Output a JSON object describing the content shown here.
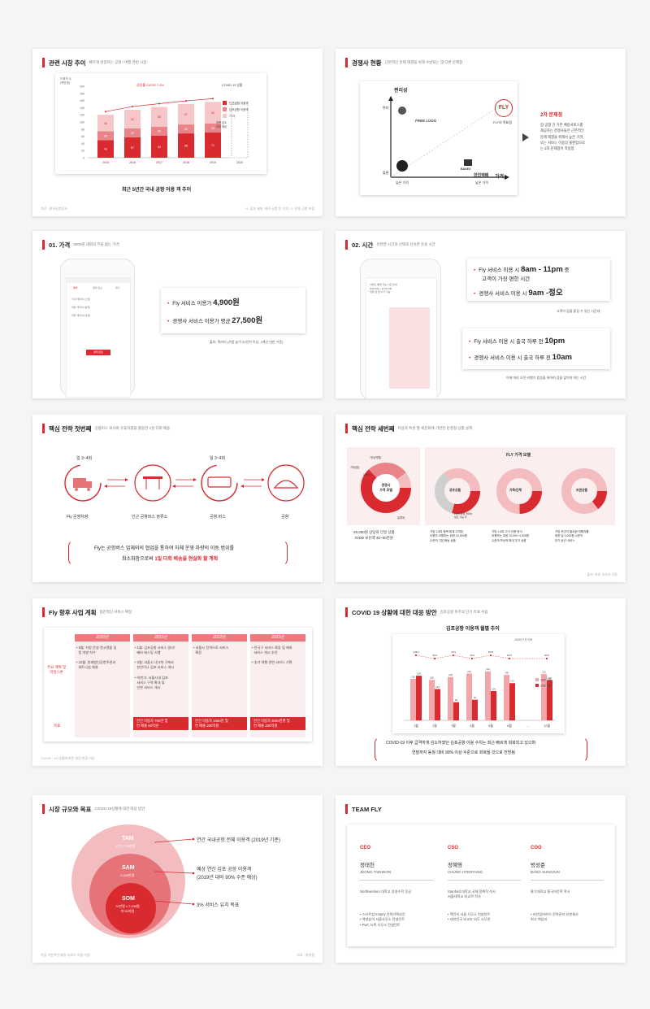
{
  "s1": {
    "title": "관련 시장 추이",
    "subtitle": "빠르게 성장하는 공항 / 여행 관련 시장",
    "y_label": "이용객 수\n(백만명)",
    "y_ticks": [
      "200",
      "180",
      "160",
      "140",
      "120",
      "100",
      "80",
      "60",
      "40",
      "20",
      "0"
    ],
    "growth": "성장률 CAGR 7.4%",
    "covid_note": "COVID 19 상황",
    "dashed_note": "대폭 감소\n미정 예상",
    "legend": [
      "인천공항 이용객",
      "김포공항 이용객",
      "기 타"
    ],
    "caption": "최근 5년간 국내 공항 이용 객 추이",
    "foot_left": "자료 : 한국공항공사",
    "foot_right": "*1. 김포 제외, 제주 공항 등 지역 / 2. 전체 공항 포함",
    "chart_data": {
      "type": "bar",
      "categories": [
        "2015",
        "2016",
        "2017",
        "2018",
        "2019",
        "2020"
      ],
      "series": [
        {
          "name": "인천공항 이용객",
          "values": [
            49,
            57,
            62,
            68,
            71,
            null
          ]
        },
        {
          "name": "김포공항 이용객",
          "values": [
            25,
            25,
            25,
            25,
            25,
            null
          ]
        },
        {
          "name": "기 타",
          "values": [
            46,
            52,
            55,
            57,
            60,
            null
          ]
        }
      ],
      "segment_labels": [
        [
          "49",
          "25",
          "46"
        ],
        [
          "57",
          "25",
          "52"
        ],
        [
          "62",
          "25",
          "55"
        ],
        [
          "68",
          "25",
          "57"
        ],
        [
          "71",
          "25",
          "60"
        ]
      ],
      "ylim": [
        0,
        200
      ]
    }
  },
  "s2": {
    "title": "경쟁사 현황",
    "subtitle": "근본적인 문제 해결을 위해 수반되는 및 다른 문제점",
    "y_axis": "편리성",
    "x_axis": "가격",
    "high": "편리",
    "low": "불편",
    "x_low": "높은 가격",
    "x_high": "낮은 가격",
    "fly_logo": "FLY",
    "fly_label": "FLY의 목표점",
    "comp1": "FREE LUGG",
    "comp2": "BAGEX",
    "comp3": "한진택배",
    "right_title": "2차 문제점",
    "right_body": "집-공항 간 기존 배송서비스를\n제공하는 경쟁사들은 근본적인\n문제 해결을 위해서 높은 가격,\n또는 서비스 이용의 불편함으로\n는 2차 문제점이 작용함"
  },
  "s3": {
    "title": "01. 가격",
    "subtitle": "5000원 내외의 부담 없는 가격",
    "b1": "Fly 서비스 이용가 ",
    "b1v": "4,900원",
    "b2": "경쟁사 서비스 이용가 평균 ",
    "b2v": "27,500원",
    "note": "출처: 뭐라더 (가방 높이 20인치 이상, 3개인 미만 기준)",
    "phone_tabs": [
      "예약",
      "결제 정보",
      "확인"
    ],
    "phone_rows": [
      "기내 캐리어 (소형)",
      "위탁 캐리어 (중형)",
      "위탁 캐리어 (대형)"
    ],
    "phone_btn": "결제 완료"
  },
  "s4": {
    "title": "02. 시간",
    "subtitle": "유연한 시간과 선택과 신속한 운송 시간",
    "b1a": "Fly 서비스 이용 시 ",
    "b1v": "8am - 11pm",
    "b1b": " 중",
    "b1c": "고객이 가장 편한 시간",
    "b2a": "경쟁사 서비스 이용 시 ",
    "b2v": "9am -정오",
    "note1": "고객이 짐을 맡길 수 있는 시간대",
    "b3a": "Fly 서비스 이용 시 출국 하루 전 ",
    "b3v": "10pm",
    "b4a": "경쟁사 서비스 이용 시 출국 하루 전 ",
    "b4v": "10am",
    "note2": "이에 따라 오전 비행기 탑승을 위하여 짐을 맡겨야 하는 시간",
    "phone_text": "서비스 예약 가능 시간 안내\n8:00 AM ~ 11:00 PM\n당일 집 앞 수거 가능"
  },
  "s5": {
    "title": "핵심 전략 첫번째",
    "subtitle": "공항버스 회사와 유휴자원을 활용한 1일 다회 배송",
    "step_top1": "일 3~4회",
    "step_top2": "일 3~4회",
    "items": [
      "Fly 운영차량",
      "인근 공항버스 정류소",
      "공항 버스",
      "공항"
    ],
    "body1": "Fly는 공항버스 업체와의 협업을 통하여 차체 운영 차량의 이동 범위를",
    "body2a": "최소화함으로써 ",
    "body2b": "1일 다회 배송을 현실화 할 계획"
  },
  "s6": {
    "title": "핵심 전략 세번째",
    "subtitle": "이용자 특성 별 세분화에 기반한 운영형 상품 설계",
    "left_circle": "경쟁사\n가격 모델",
    "left_labels": [
      "기타(약원)",
      "기타(방)",
      "10%",
      "유류비"
    ],
    "left_caption": "25,000원 상당의 단일 상품\n/ODD 보유액 30~50만원",
    "right_title": "FLY 가격 모델",
    "circles": [
      "공유상품",
      "가족/단체",
      "보관상품"
    ],
    "circle_notes": [
      "Fly의 대형 캐리어\n필요 가능 후"
    ],
    "descs": [
      "가방 1,8여 품목 회계 고객된\n이용자 여행하는 위한 15,000원\n수준의 기본 배송 상품",
      "가방 1.8여 고가 이용 방식\n여행하는 위한 10,000~4,900원\n수준의 보상적 확대 무가 상품",
      "가방 보관이 필요한 여행자를\n위한 일 4,900원 수준의\n부가 상관 서비스"
    ],
    "foot": "출처: 자료 리서치 기준"
  },
  "s7": {
    "title": "Fly 향후 사업 계획",
    "subtitle": "점진적인 서비스 확장",
    "years": [
      "2020년",
      "2021년",
      "2022년",
      "2023년"
    ],
    "row1": "주요 계획 및\n마일스톤",
    "row2": "목표",
    "cells": [
      "• 8월: 차량 운영 렌고렌을 및\n  랩 개발 착수\n\n• 10월: 관세법인공항주관과\n  파트너십 체결",
      "• 1월: 김포공항 서비스 말리/\n  베타 테스팅 시행\n\n• 3월: 서울시 내 3개 구에서\n  한전이나 김포 서비스 개시\n\n• 하반기: 서울시내 김포\n  서비스 구역 확대 및\n  인천 서비스 개시",
      "• 서울시 전역으로 서비스\n  확장",
      "• 전국구 서비스 확장 및 해외\n  서비스 개시 추진\n\n• 추가 여행 관련 서비스 기획"
    ],
    "goals": [
      "연간 이용자 700만 및\n연 매출 50억원",
      "연간 이용자 1960만 및\n연 매출 200억원",
      "연간 이용자 3000만명 및\n연 매출 200억원"
    ],
    "foot": "COVID - 19 상황에 따른 일정 변경 가능"
  },
  "s8": {
    "title": "COVID 19 상황에 대한 대응 방안",
    "subtitle": "김포공항 위주의 단기 목표 수립",
    "chart_title": "김포공항 이용객 월별 추이",
    "legend": [
      "19년 기준",
      "20년 기준"
    ],
    "legend_top": "2019년 1월 이후",
    "body1": "COVID-19 이후 급격하게 감소하였던 김포공항 이용 수치는 최근 빠르게 회복되고 있으며",
    "body2": "연말까지 동월 대비 90% 이상 수준으로 회복될 것으로 전망됨",
    "chart_data": {
      "type": "bar",
      "categories": [
        "1월",
        "2월",
        "3월",
        "4월",
        "5월",
        "6월",
        "...",
        "12월"
      ],
      "series": [
        {
          "name": "19년 기준",
          "values": [
            190,
            185,
            198,
            214,
            224,
            208,
            null,
            212
          ]
        },
        {
          "name": "20년 기준",
          "values": [
            204,
            143,
            83,
            94,
            134,
            170,
            null,
            184
          ]
        }
      ],
      "line_labels": [
        "103%",
        "42%",
        "47%",
        "44%",
        "60%",
        "81%",
        "90%"
      ]
    }
  },
  "s9": {
    "title": "시장 규모와 목표",
    "subtitle": "COVID-19상황에 대한 대응 방안",
    "tam": "TAM",
    "tam_v": "1억 3,700만명",
    "sam": "SAM",
    "sam_v": "2,200만명",
    "som": "SOM",
    "som_v": "70만명 x 7,000원\n약 50억원",
    "l1": "연간 국내공항 전체 이용객 (2019년 기준)",
    "l2a": "예상 연간 김포 공항 이용객",
    "l2b": "(2019년 대비 90% 수준 예상)",
    "l3": "3% 서비스 유치 목표",
    "foot_left": "가장 기본적인 배송 서비스 이용 가정",
    "foot_right": "자료 : 통계청"
  },
  "s10": {
    "title": "TEAM FLY",
    "members": [
      {
        "role": "CEO",
        "name": "정태헌",
        "eng": "JEONG TAEHEON",
        "edu": "Northwestern 대학교 응용수학 전공",
        "exp": "▪ 스타트업 Inspiry 전략기획부문\n▪ 액센츄어 서울사무소 컨설턴트\n▪ PwC 뉴욕 사무소 컨설턴트"
      },
      {
        "role": "CSO",
        "name": "정혜영",
        "eng": "CHUNG HYERYUNG",
        "edu": "Stanford 대학교 국제 정책학 석사\n서울대학교 외교학 학사",
        "exp": "▪ 맥킨지 서울 사무소 컨설턴트\n▪ 대한민국 외교부 외무 사무관"
      },
      {
        "role": "COO",
        "name": "방성준",
        "eng": "BANG SUNGJUN",
        "edu": "홍익대학교 홍국어문학 학사",
        "exp": "▪ 라인업비하이 전략관리 유한회사\n최고 책임자"
      }
    ]
  }
}
